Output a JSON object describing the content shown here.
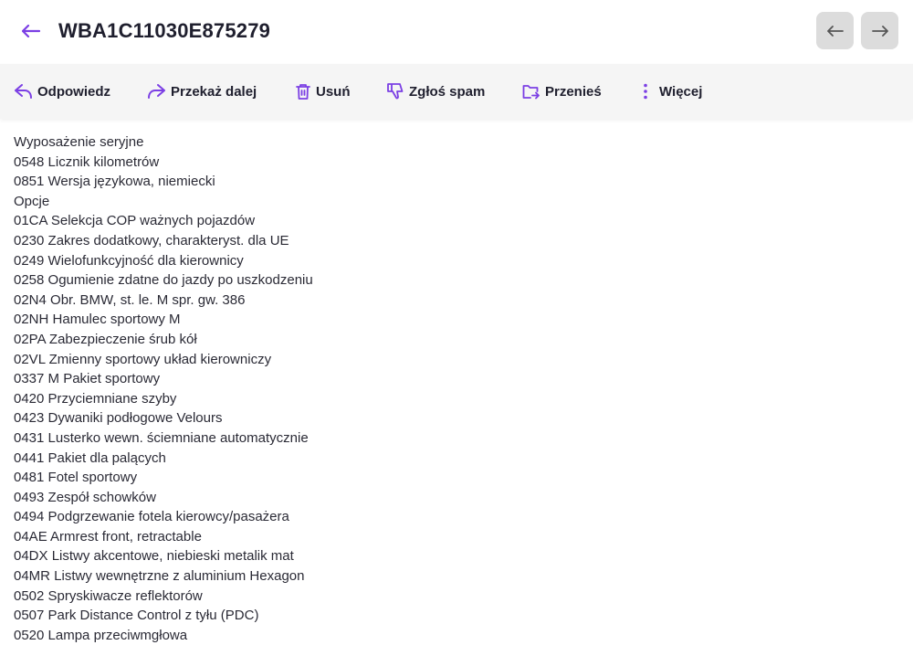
{
  "header": {
    "subject": "WBA1C11030E875279"
  },
  "toolbar": {
    "reply": "Odpowiedz",
    "forward": "Przekaż dalej",
    "delete": "Usuń",
    "spam": "Zgłoś spam",
    "move": "Przenieś",
    "more": "Więcej"
  },
  "icons": {
    "back": "arrow-left-icon",
    "prev": "arrow-left-icon",
    "next": "arrow-right-icon",
    "reply": "reply-icon",
    "forward": "forward-icon",
    "delete": "trash-icon",
    "spam": "thumbs-down-icon",
    "move": "folder-move-icon",
    "more": "more-vertical-icon"
  },
  "colors": {
    "accent": "#7b3fe4",
    "toolbar_bg": "#f5f5f5",
    "nav_button_bg": "#dcdcdc"
  },
  "body": {
    "lines": [
      "Wyposażenie seryjne",
      "0548 Licznik kilometrów",
      "0851 Wersja językowa, niemiecki",
      "Opcje",
      "01CA Selekcja COP ważnych pojazdów",
      "0230 Zakres dodatkowy, charakteryst. dla UE",
      "0249 Wielofunkcyjność dla kierownicy",
      "0258 Ogumienie zdatne do jazdy po uszkodzeniu",
      "02N4 Obr. BMW, st. le. M spr. gw. 386",
      "02NH Hamulec sportowy M",
      "02PA Zabezpieczenie śrub kół",
      "02VL Zmienny sportowy układ kierowniczy",
      "0337 M Pakiet sportowy",
      "0420 Przyciemniane szyby",
      "0423 Dywaniki podłogowe Velours",
      "0431 Lusterko wewn. ściemniane automatycznie",
      "0441 Pakiet dla palących",
      "0481 Fotel sportowy",
      "0493 Zespół schowków",
      "0494 Podgrzewanie fotela kierowcy/pasażera",
      "04AE Armrest front, retractable",
      "04DX Listwy akcentowe, niebieski metalik mat",
      "04MR Listwy wewnętrzne z aluminium Hexagon",
      "0502 Spryskiwacze reflektorów",
      "0507 Park Distance Control z tyłu (PDC)",
      "0520 Lampa przeciwmgłowa"
    ]
  }
}
